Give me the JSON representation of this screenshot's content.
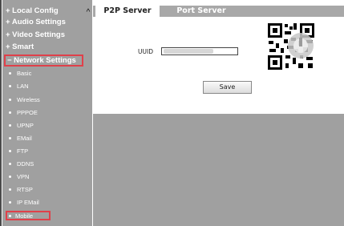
{
  "sidebar": {
    "scroll_up": "^",
    "top_items": [
      "+ Local Config",
      "+ Audio Settings",
      "+ Video Settings",
      "+ Smart"
    ],
    "selected_section": "− Network Settings",
    "sub_items": [
      "Basic",
      "LAN",
      "Wireless",
      "PPPOE",
      "UPNP",
      "EMail",
      "FTP",
      "DDNS",
      "VPN",
      "RTSP",
      "IP EMail"
    ],
    "active_sub_item": "Mobile"
  },
  "tabs": {
    "active": "P2P Server",
    "other": "Port Server"
  },
  "form": {
    "uuid_label": "UUID",
    "uuid_value": "",
    "save_label": "Save"
  },
  "colors": {
    "sidebar_bg": "#a0a0a0",
    "highlight_border": "#e0404a",
    "tabbar_bg": "#a8a8a8"
  },
  "icons": {
    "qr": "qr-code-icon"
  }
}
